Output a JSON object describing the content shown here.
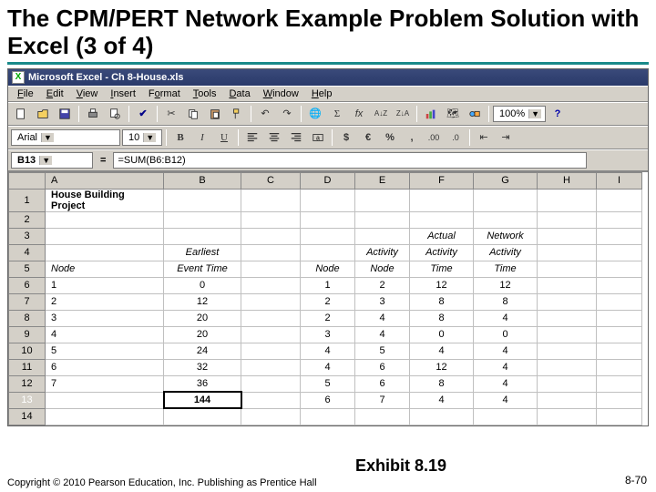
{
  "slide": {
    "title": "The CPM/PERT Network Example Problem Solution with Excel (3 of 4)",
    "copyright": "Copyright © 2010 Pearson Education, Inc. Publishing as Prentice Hall",
    "exhibit": "Exhibit 8.19",
    "slide_number": "8-70"
  },
  "window": {
    "title": "Microsoft Excel - Ch 8-House.xls",
    "menus": [
      "File",
      "Edit",
      "View",
      "Insert",
      "Format",
      "Tools",
      "Data",
      "Window",
      "Help"
    ],
    "font_name": "Arial",
    "font_size": "10",
    "zoom": "100%",
    "name_box": "B13",
    "formula": "=SUM(B6:B12)"
  },
  "columns": [
    "A",
    "B",
    "C",
    "D",
    "E",
    "F",
    "G",
    "H",
    "I"
  ],
  "rows": [
    {
      "n": "1",
      "A": "House Building Project",
      "Abold": true
    },
    {
      "n": "2"
    },
    {
      "n": "3",
      "F": "Actual",
      "G": "Network",
      "Fi": true,
      "Gi": true
    },
    {
      "n": "4",
      "B": "Earliest",
      "E": "Activity",
      "F": "Activity",
      "G": "Activity",
      "Bi": true,
      "Ei": true,
      "Fi": true,
      "Gi": true
    },
    {
      "n": "5",
      "A": "Node",
      "B": "Event Time",
      "D": "Node",
      "E": "Node",
      "F": "Time",
      "G": "Time",
      "Ai": true,
      "Bi": true,
      "Di": true,
      "Ei": true,
      "Fi": true,
      "Gi": true
    },
    {
      "n": "6",
      "A": "1",
      "B": "0",
      "D": "1",
      "E": "2",
      "F": "12",
      "G": "12"
    },
    {
      "n": "7",
      "A": "2",
      "B": "12",
      "D": "2",
      "E": "3",
      "F": "8",
      "G": "8"
    },
    {
      "n": "8",
      "A": "3",
      "B": "20",
      "D": "2",
      "E": "4",
      "F": "8",
      "G": "4"
    },
    {
      "n": "9",
      "A": "4",
      "B": "20",
      "D": "3",
      "E": "4",
      "F": "0",
      "G": "0"
    },
    {
      "n": "10",
      "A": "5",
      "B": "24",
      "D": "4",
      "E": "5",
      "F": "4",
      "G": "4"
    },
    {
      "n": "11",
      "A": "6",
      "B": "32",
      "D": "4",
      "E": "6",
      "F": "12",
      "G": "4"
    },
    {
      "n": "12",
      "A": "7",
      "B": "36",
      "D": "5",
      "E": "6",
      "F": "8",
      "G": "4"
    },
    {
      "n": "13",
      "B": "144",
      "Bbold": true,
      "D": "6",
      "E": "7",
      "F": "4",
      "G": "4",
      "active": true,
      "selB": true
    },
    {
      "n": "14"
    }
  ]
}
